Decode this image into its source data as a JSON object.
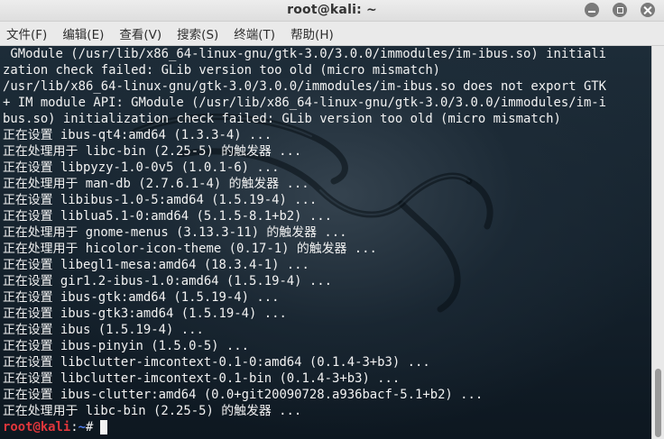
{
  "window": {
    "title": "root@kali: ~",
    "controls": [
      "minimize-icon",
      "maximize-icon",
      "close-icon"
    ]
  },
  "menubar": {
    "items": [
      {
        "label": "文件(F)"
      },
      {
        "label": "编辑(E)"
      },
      {
        "label": "查看(V)"
      },
      {
        "label": "搜索(S)"
      },
      {
        "label": "终端(T)"
      },
      {
        "label": "帮助(H)"
      }
    ]
  },
  "terminal": {
    "lines": [
      " GModule (/usr/lib/x86_64-linux-gnu/gtk-3.0/3.0.0/immodules/im-ibus.so) initiali",
      "zation check failed: GLib version too old (micro mismatch)",
      "/usr/lib/x86_64-linux-gnu/gtk-3.0/3.0.0/immodules/im-ibus.so does not export GTK",
      "+ IM module API: GModule (/usr/lib/x86_64-linux-gnu/gtk-3.0/3.0.0/immodules/im-i",
      "bus.so) initialization check failed: GLib version too old (micro mismatch)",
      "正在设置 ibus-qt4:amd64 (1.3.3-4) ...",
      "正在处理用于 libc-bin (2.25-5) 的触发器 ...",
      "正在设置 libpyzy-1.0-0v5 (1.0.1-6) ...",
      "正在处理用于 man-db (2.7.6.1-4) 的触发器 ...",
      "正在设置 libibus-1.0-5:amd64 (1.5.19-4) ...",
      "正在设置 liblua5.1-0:amd64 (5.1.5-8.1+b2) ...",
      "正在处理用于 gnome-menus (3.13.3-11) 的触发器 ...",
      "正在处理用于 hicolor-icon-theme (0.17-1) 的触发器 ...",
      "正在设置 libegl1-mesa:amd64 (18.3.4-1) ...",
      "正在设置 gir1.2-ibus-1.0:amd64 (1.5.19-4) ...",
      "正在设置 ibus-gtk:amd64 (1.5.19-4) ...",
      "正在设置 ibus-gtk3:amd64 (1.5.19-4) ...",
      "正在设置 ibus (1.5.19-4) ...",
      "正在设置 ibus-pinyin (1.5.0-5) ...",
      "正在设置 libclutter-imcontext-0.1-0:amd64 (0.1.4-3+b3) ...",
      "正在设置 libclutter-imcontext-0.1-bin (0.1.4-3+b3) ...",
      "正在设置 ibus-clutter:amd64 (0.0+git20090728.a936bacf-5.1+b2) ...",
      "正在处理用于 libc-bin (2.25-5) 的触发器 ..."
    ],
    "prompt": {
      "user_host": "root@kali",
      "separator": ":",
      "directory": "~",
      "symbol": "#"
    },
    "colors": {
      "prompt_user": "#e0363b",
      "prompt_dir": "#4f7ef0",
      "text": "#f2f2f2",
      "background": "#1a2a36"
    }
  }
}
